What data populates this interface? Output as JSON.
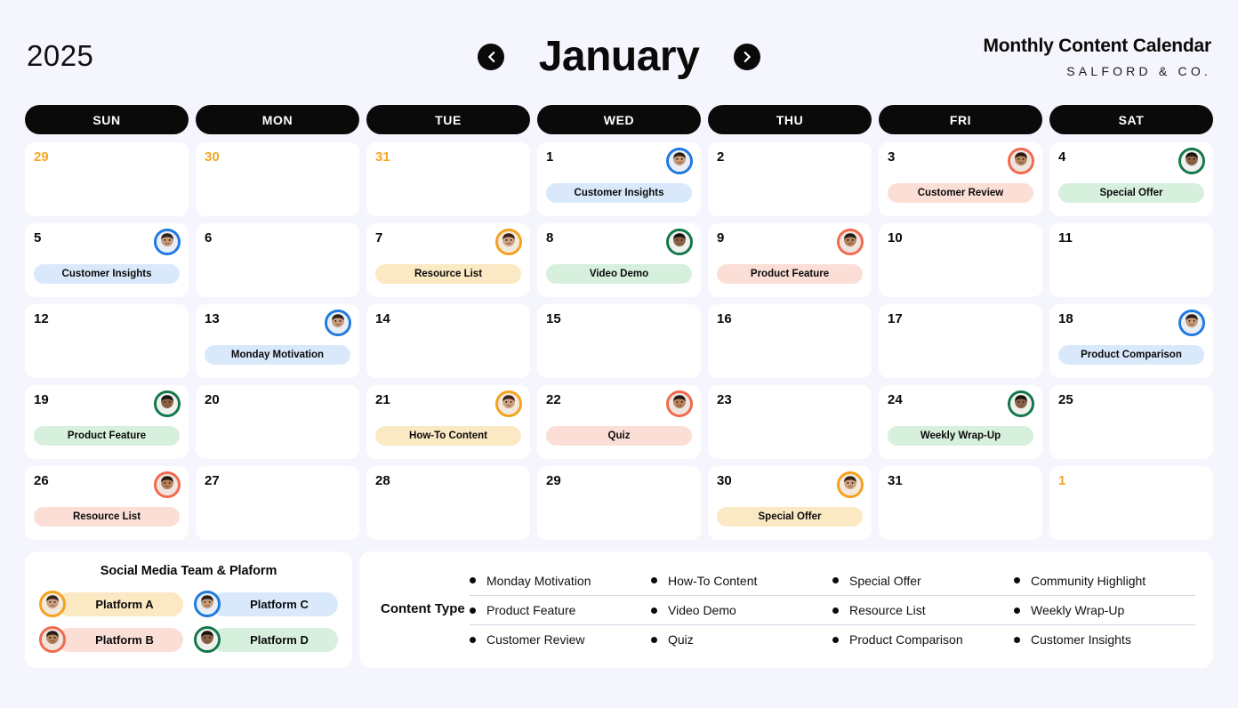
{
  "header": {
    "year": "2025",
    "month": "January",
    "prev_label": "chevron-left-icon",
    "next_label": "chevron-right-icon",
    "title": "Monthly Content Calendar",
    "brand": "SALFORD & CO."
  },
  "weekdays": [
    "SUN",
    "MON",
    "TUE",
    "WED",
    "THU",
    "FRI",
    "SAT"
  ],
  "colors": {
    "background": "#f5f5fd",
    "cell": "#ffffff",
    "header_bar": "#0a0a0a",
    "muted_day": "#f5a623",
    "blue_ring": "#1e7ae0",
    "coral_ring": "#f2694e",
    "green_ring": "#12774a",
    "amber_ring": "#f5a21a",
    "blue_pill": "#d9e9fb",
    "coral_pill": "#fbdfd6",
    "green_pill": "#d7efdd",
    "amber_pill": "#fbe9c4"
  },
  "weeks": [
    [
      {
        "day": "29",
        "muted": true,
        "event": null,
        "tone": null,
        "avatar": null
      },
      {
        "day": "30",
        "muted": true,
        "event": null,
        "tone": null,
        "avatar": null
      },
      {
        "day": "31",
        "muted": true,
        "event": null,
        "tone": null,
        "avatar": null
      },
      {
        "day": "1",
        "muted": false,
        "event": "Customer Insights",
        "tone": "blue",
        "avatar": "blue"
      },
      {
        "day": "2",
        "muted": false,
        "event": null,
        "tone": null,
        "avatar": null
      },
      {
        "day": "3",
        "muted": false,
        "event": "Customer Review",
        "tone": "coral",
        "avatar": "coral"
      },
      {
        "day": "4",
        "muted": false,
        "event": "Special Offer",
        "tone": "green",
        "avatar": "green"
      }
    ],
    [
      {
        "day": "5",
        "muted": false,
        "event": "Customer Insights",
        "tone": "blue",
        "avatar": "blue"
      },
      {
        "day": "6",
        "muted": false,
        "event": null,
        "tone": null,
        "avatar": null
      },
      {
        "day": "7",
        "muted": false,
        "event": "Resource List",
        "tone": "amber",
        "avatar": "amber"
      },
      {
        "day": "8",
        "muted": false,
        "event": "Video Demo",
        "tone": "green",
        "avatar": "green"
      },
      {
        "day": "9",
        "muted": false,
        "event": "Product Feature",
        "tone": "coral",
        "avatar": "coral"
      },
      {
        "day": "10",
        "muted": false,
        "event": null,
        "tone": null,
        "avatar": null
      },
      {
        "day": "11",
        "muted": false,
        "event": null,
        "tone": null,
        "avatar": null
      }
    ],
    [
      {
        "day": "12",
        "muted": false,
        "event": null,
        "tone": null,
        "avatar": null
      },
      {
        "day": "13",
        "muted": false,
        "event": "Monday Motivation",
        "tone": "blue",
        "avatar": "blue"
      },
      {
        "day": "14",
        "muted": false,
        "event": null,
        "tone": null,
        "avatar": null
      },
      {
        "day": "15",
        "muted": false,
        "event": null,
        "tone": null,
        "avatar": null
      },
      {
        "day": "16",
        "muted": false,
        "event": null,
        "tone": null,
        "avatar": null
      },
      {
        "day": "17",
        "muted": false,
        "event": null,
        "tone": null,
        "avatar": null
      },
      {
        "day": "18",
        "muted": false,
        "event": "Product Comparison",
        "tone": "blue",
        "avatar": "blue"
      }
    ],
    [
      {
        "day": "19",
        "muted": false,
        "event": "Product Feature",
        "tone": "green",
        "avatar": "green"
      },
      {
        "day": "20",
        "muted": false,
        "event": null,
        "tone": null,
        "avatar": null
      },
      {
        "day": "21",
        "muted": false,
        "event": "How-To Content",
        "tone": "amber",
        "avatar": "amber"
      },
      {
        "day": "22",
        "muted": false,
        "event": "Quiz",
        "tone": "coral",
        "avatar": "coral"
      },
      {
        "day": "23",
        "muted": false,
        "event": null,
        "tone": null,
        "avatar": null
      },
      {
        "day": "24",
        "muted": false,
        "event": "Weekly Wrap-Up",
        "tone": "green",
        "avatar": "green"
      },
      {
        "day": "25",
        "muted": false,
        "event": null,
        "tone": null,
        "avatar": null
      }
    ],
    [
      {
        "day": "26",
        "muted": false,
        "event": "Resource List",
        "tone": "coral",
        "avatar": "coral"
      },
      {
        "day": "27",
        "muted": false,
        "event": null,
        "tone": null,
        "avatar": null
      },
      {
        "day": "28",
        "muted": false,
        "event": null,
        "tone": null,
        "avatar": null
      },
      {
        "day": "29",
        "muted": false,
        "event": null,
        "tone": null,
        "avatar": null
      },
      {
        "day": "30",
        "muted": false,
        "event": "Special Offer",
        "tone": "amber",
        "avatar": "amber"
      },
      {
        "day": "31",
        "muted": false,
        "event": null,
        "tone": null,
        "avatar": null
      },
      {
        "day": "1",
        "muted": true,
        "event": null,
        "tone": null,
        "avatar": null
      }
    ]
  ],
  "team": {
    "title": "Social Media Team & Plaform",
    "items": [
      {
        "label": "Platform A",
        "tone": "amber",
        "avatar": "amber"
      },
      {
        "label": "Platform C",
        "tone": "blue",
        "avatar": "blue"
      },
      {
        "label": "Platform B",
        "tone": "coral",
        "avatar": "coral"
      },
      {
        "label": "Platform D",
        "tone": "green",
        "avatar": "green"
      }
    ]
  },
  "content_type": {
    "label": "Content Type",
    "rows": [
      [
        "Monday Motivation",
        "How-To Content",
        "Special Offer",
        "Community Highlight"
      ],
      [
        "Product Feature",
        "Video Demo",
        "Resource List",
        "Weekly Wrap-Up"
      ],
      [
        "Customer Review",
        "Quiz",
        "Product Comparison",
        "Customer Insights"
      ]
    ]
  }
}
